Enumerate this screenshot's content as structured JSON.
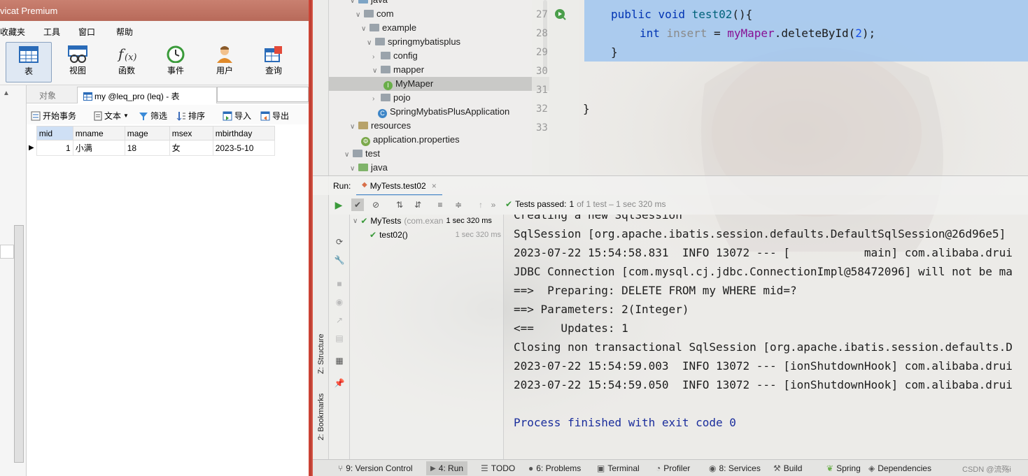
{
  "navicat": {
    "title": "vicat Premium",
    "menu": [
      "收藏夹",
      "工具",
      "窗口",
      "帮助"
    ],
    "toolbar": [
      {
        "label": "表",
        "icon": "table-icon"
      },
      {
        "label": "视图",
        "icon": "view-icon"
      },
      {
        "label": "函数",
        "icon": "function-icon"
      },
      {
        "label": "事件",
        "icon": "event-icon"
      },
      {
        "label": "用户",
        "icon": "user-icon"
      },
      {
        "label": "查询",
        "icon": "query-icon"
      }
    ],
    "tabs": {
      "objects": "对象",
      "table_tab": "my @leq_pro (leq) - 表"
    },
    "subtoolbar": {
      "begin": "开始事务",
      "text": "文本",
      "filter": "筛选",
      "sort": "排序",
      "import": "导入",
      "export": "导出"
    },
    "grid": {
      "columns": [
        "mid",
        "mname",
        "mage",
        "msex",
        "mbirthday"
      ],
      "rows": [
        [
          "1",
          "小满",
          "18",
          "女",
          "2023-5-10"
        ]
      ]
    }
  },
  "idea": {
    "tree": [
      {
        "label": "java",
        "kind": "src"
      },
      {
        "label": "com",
        "kind": "pkg"
      },
      {
        "label": "example",
        "kind": "pkg"
      },
      {
        "label": "springmybatisplus",
        "kind": "pkg"
      },
      {
        "label": "config",
        "kind": "pkg"
      },
      {
        "label": "mapper",
        "kind": "pkg"
      },
      {
        "label": "MyMaper",
        "kind": "interface"
      },
      {
        "label": "pojo",
        "kind": "pkg"
      },
      {
        "label": "SpringMybatisPlusApplication",
        "kind": "class"
      },
      {
        "label": "resources",
        "kind": "res"
      },
      {
        "label": "application.properties",
        "kind": "props"
      },
      {
        "label": "test",
        "kind": "pkg"
      },
      {
        "label": "java",
        "kind": "green"
      }
    ],
    "line_numbers": [
      "27",
      "28",
      "29",
      "30",
      "31",
      "32",
      "33"
    ],
    "code": {
      "line27_kw1": "public",
      "line27_kw2": "void",
      "line27_fn": "test02",
      "line27_rest": "(){",
      "line28_kw": "int",
      "line28_var": "insert",
      "line28_eq": " = ",
      "line28_field": "myMaper",
      "line28_call": ".deleteById(",
      "line28_num": "2",
      "line28_end": ");",
      "line29": "}",
      "line32": "}"
    },
    "run": {
      "label": "Run:",
      "config": "MyTests.test02",
      "status_prefix": "Tests passed:",
      "status_count": "1",
      "status_rest": "of 1 test – 1 sec 320 ms",
      "tree": [
        {
          "name": "MyTests",
          "detail": "(com.exan",
          "time": "1 sec 320 ms"
        },
        {
          "name": "test02()",
          "detail": "",
          "time": "1 sec 320 ms"
        }
      ]
    },
    "console": [
      "Creating a new SqlSession",
      "SqlSession [org.apache.ibatis.session.defaults.DefaultSqlSession@26d96e5]",
      "2023-07-22 15:54:58.831  INFO 13072 --- [           main] com.alibaba.drui",
      "JDBC Connection [com.mysql.cj.jdbc.ConnectionImpl@58472096] will not be ma",
      "==>  Preparing: DELETE FROM my WHERE mid=?",
      "==> Parameters: 2(Integer)",
      "<==    Updates: 1",
      "Closing non transactional SqlSession [org.apache.ibatis.session.defaults.D",
      "2023-07-22 15:54:59.003  INFO 13072 --- [ionShutdownHook] com.alibaba.drui",
      "2023-07-22 15:54:59.050  INFO 13072 --- [ionShutdownHook] com.alibaba.drui",
      "",
      "Process finished with exit code 0"
    ],
    "side_labels": {
      "structure": "Z: Structure",
      "bookmarks": "2: Bookmarks"
    },
    "statusbar": [
      {
        "label": "9: Version Control",
        "icon": "branch-icon"
      },
      {
        "label": "4: Run",
        "icon": "run-icon"
      },
      {
        "label": "TODO",
        "icon": "todo-icon"
      },
      {
        "label": "6: Problems",
        "icon": "problems-icon"
      },
      {
        "label": "Terminal",
        "icon": "terminal-icon"
      },
      {
        "label": "Profiler",
        "icon": "profiler-icon"
      },
      {
        "label": "8: Services",
        "icon": "services-icon"
      },
      {
        "label": "Build",
        "icon": "build-icon"
      },
      {
        "label": "Spring",
        "icon": "spring-icon"
      },
      {
        "label": "Dependencies",
        "icon": "dependencies-icon"
      }
    ],
    "watermark": "CSDN @流殇i"
  }
}
